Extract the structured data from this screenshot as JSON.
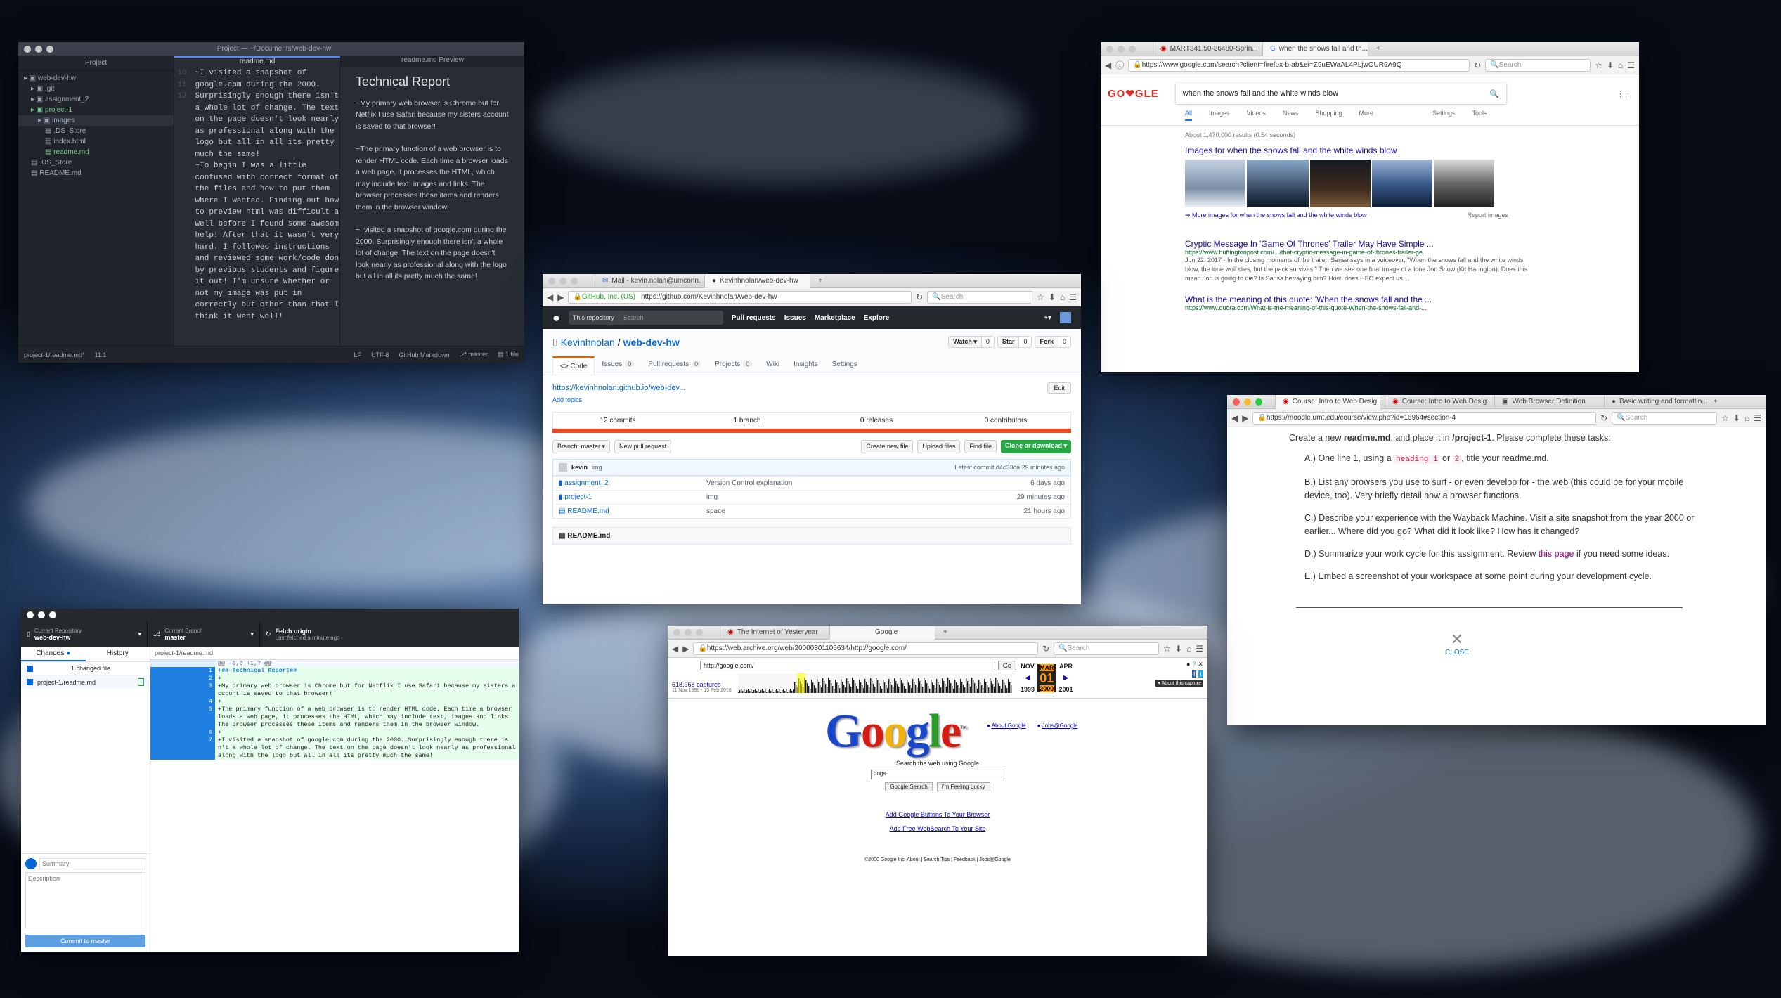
{
  "atom": {
    "title": "Project — ~/Documents/web-dev-hw",
    "project_label": "Project",
    "tab_readme": "readme.md",
    "tab_preview": "readme.md Preview",
    "tree": [
      "web-dev-hw",
      ".git",
      "assignment_2",
      "project-1",
      "images",
      ".DS_Store",
      "index.html",
      "readme.md",
      ".DS_Store",
      "README.md"
    ],
    "code": [
      "~I visited a snapshot of",
      "google.com during the 2000.",
      "Surprisingly enough there isn't",
      "a whole lot of change. The text",
      "on the page doesn't look nearly",
      "as professional along with the",
      "logo but all in all its pretty",
      "much the same!",
      "",
      "~To begin I was a little",
      "confused with correct format of",
      "the files and how to put them",
      "where I wanted. Finding out how",
      "to preview html was difficult as",
      "well before I found some awesome",
      "help! After that it wasn't very",
      "hard. I followed instructions",
      "and reviewed some work/code done",
      "by previous students and figured",
      "it out! I'm unsure whether or",
      "not my image was put in",
      "correctly but other than that I",
      "think it went well!",
      "",
      "",
      ""
    ],
    "line_nums": [
      "",
      "",
      "",
      "",
      "",
      "",
      "",
      "",
      "",
      "",
      "",
      "",
      "",
      "",
      "",
      "",
      "",
      "",
      "",
      "",
      "",
      "",
      "",
      "10",
      "11",
      "12"
    ],
    "preview_title": "Technical Report",
    "preview_paras": [
      "~My primary web browser is Chrome but for Netflix I use Safari because my sisters account is saved to that browser!",
      "~The primary function of a web browser is to render HTML code. Each time a browser loads a web page, it processes the HTML, which may include text, images and links. The browser processes these items and renders them in the browser window.",
      "~I visited a snapshot of google.com during the 2000. Surprisingly enough there isn't a whole lot of change. The text on the page doesn't look nearly as professional along with the logo but all in all its pretty much the same!"
    ],
    "status_left": "project-1/readme.md*",
    "status_pos": "11:1",
    "status_right": [
      "LF",
      "UTF-8",
      "GitHub Markdown",
      "master",
      "1 file"
    ]
  },
  "google": {
    "tab1": "MART341.50-36480-Sprin...",
    "tab2": "when the snows fall and th...",
    "url": "https://www.google.com/search?client=firefox-b-ab&ei=Z9uEWaAL4PLjwOUR9A9Q",
    "search_ph": "Search",
    "logo": "GO❤GLE",
    "query": "when the snows fall and the white winds blow",
    "tabs": [
      "All",
      "Images",
      "Videos",
      "News",
      "Shopping",
      "More",
      "Settings",
      "Tools"
    ],
    "stats": "About 1,470,000 results (0.54 seconds)",
    "images_head": "Images for when the snows fall and the white winds blow",
    "more_images": "More images for when the snows fall and the white winds blow",
    "report": "Report images",
    "r1_title": "Cryptic Message In 'Game Of Thrones' Trailer May Have Simple ...",
    "r1_url": "https://www.huffingtonpost.com/.../that-cryptic-message-in-game-of-thrones-trailer-ge...",
    "r1_snip": "Jun 22, 2017 - In the closing moments of the trailer, Sansa says in a voiceover, \"When the snows fall and the white winds blow, the lone wolf dies, but the pack survives.\" Then we see one final image of a lone Jon Snow (Kit Harington). Does this mean Jon is going to die? Is Sansa betraying him? How! does HBO expect us ...",
    "r2_title": "What is the meaning of this quote: 'When the snows fall and the ...",
    "r2_url": "https://www.quora.com/What-is-the-meaning-of-this-quote-When-the-snows-fall-and-..."
  },
  "github": {
    "tab1": "Mail - kevin.nolan@umconn...",
    "tab2": "Kevinhnolan/web-dev-hw",
    "url_org": "GitHub, Inc. (US)",
    "url": "https://github.com/Kevinhnolan/web-dev-hw",
    "search_ph": "Search",
    "scope": "This repository",
    "gsearch": "Search",
    "nav": [
      "Pull requests",
      "Issues",
      "Marketplace",
      "Explore"
    ],
    "owner": "Kevinhnolan",
    "repo": "web-dev-hw",
    "watch": "Watch ▾",
    "watch_n": "0",
    "star": "Star",
    "star_n": "0",
    "fork": "Fork",
    "fork_n": "0",
    "rtabs": [
      "<> Code",
      "Issues",
      "Pull requests",
      "Projects",
      "Wiki",
      "Insights",
      "Settings"
    ],
    "rtab_counts": [
      "",
      "0",
      "0",
      "0",
      "",
      "",
      ""
    ],
    "site": "https://kevinhnolan.github.io/web-dev...",
    "add_topics": "Add topics",
    "edit": "Edit",
    "stats": [
      "12 commits",
      "1 branch",
      "0 releases",
      "0 contributors"
    ],
    "branch": "Branch: master ▾",
    "new_pr": "New pull request",
    "create": "Create new file",
    "upload": "Upload files",
    "find": "Find file",
    "clone": "Clone or download ▾",
    "commit_user": "kevin",
    "commit_msg": "img",
    "latest": "Latest commit d4c33ca 29 minutes ago",
    "files": [
      {
        "name": "assignment_2",
        "msg": "Version Control explanation",
        "age": "6 days ago"
      },
      {
        "name": "project-1",
        "msg": "img",
        "age": "29 minutes ago"
      },
      {
        "name": "README.md",
        "msg": "space",
        "age": "21 hours ago"
      }
    ],
    "readme": "README.md"
  },
  "moodle": {
    "tab1": "Course: Intro to Web Desig...",
    "tab2": "Course: Intro to Web Desig...",
    "tab3": "Web Browser Definition",
    "tab4": "Basic writing and formattin...",
    "url": "https://moodle.umt.edu/course/view.php?id=16964#section-4",
    "search_ph": "Search",
    "intro_a": "Create a new ",
    "intro_b": "readme.md",
    "intro_c": ", and place it in ",
    "intro_d": "/project-1",
    "intro_e": ". Please complete these tasks:",
    "a_pre": "A.) One line 1, using a ",
    "a_code1": "heading 1",
    "a_or": " or ",
    "a_code2": "2",
    "a_post": ", title your readme.md.",
    "b": "B.) List any browsers you use to surf - or even develop for - the web (this could be for your mobile device, too). Very briefly detail how a browser functions.",
    "c": "C.) Describe your experience with the Wayback Machine. Visit a site snapshot from the year 2000 or earlier... Where did you go? What did it look like? How has it changed?",
    "d_pre": "D.) Summarize your work cycle for this assignment. Review ",
    "d_link": "this page",
    "d_post": " if you need some ideas.",
    "e": "E.) Embed a screenshot of your workspace at some point during your development cycle.",
    "close": "CLOSE"
  },
  "ghdesk": {
    "repo_label": "Current Repository",
    "repo": "web-dev-hw",
    "branch_label": "Current Branch",
    "branch": "master",
    "fetch": "Fetch origin",
    "fetch_sub": "Last fetched a minute ago",
    "changes": "Changes",
    "history": "History",
    "changed": "1 changed file",
    "file": "project-1/readme.md",
    "hunk": "@@ -0,0 +1,7 @@",
    "diff": [
      {
        "n": "1",
        "t": "+## Technical Report##"
      },
      {
        "n": "2",
        "t": "+"
      },
      {
        "n": "3",
        "t": "+My primary web browser is Chrome but for Netflix I use Safari because my sisters account is saved to that browser!"
      },
      {
        "n": "4",
        "t": "+"
      },
      {
        "n": "5",
        "t": "+The primary function of a web browser is to render HTML code. Each time a browser loads a web page, it processes the HTML, which may include text, images and links. The browser processes these items and renders them in the browser window."
      },
      {
        "n": "6",
        "t": "+"
      },
      {
        "n": "7",
        "t": "+I visited a snapshot of google.com during the 2000. Surprisingly enough there isn't a whole lot of change. The text on the page doesn't look nearly as professional along with the logo but all in all its pretty much the same!"
      }
    ],
    "summary_ph": "Summary",
    "desc_ph": "Description",
    "commit": "Commit to master"
  },
  "wayback": {
    "tab1": "The Internet of Yesteryear",
    "tab2": "Google",
    "url": "https://web.archive.org/web/20000301105634/http://google.com/",
    "search_ph": "Search",
    "wb_url": "http://google.com/",
    "go": "Go",
    "captures": "618,968 captures",
    "range": "11 Nov 1998 - 13 Feb 2018",
    "month_prev": "NOV",
    "month_cur": "MAR",
    "month_next": "APR",
    "day": "01",
    "year_prev": "1999",
    "year_cur": "2000",
    "year_next": "2001",
    "about": "About this capture",
    "logo": "Google",
    "about_g": "About Google",
    "jobs": "Jobs@Google",
    "search_web": "Search the web using Google",
    "query": "dogs",
    "btn1": "Google Search",
    "btn2": "I'm Feeling Lucky",
    "link1": "Add Google Buttons To Your Browser",
    "link2": "Add Free WebSearch To Your Site",
    "footer": "©2000 Google Inc. About | Search Tips | Feedback | Jobs@Google"
  }
}
